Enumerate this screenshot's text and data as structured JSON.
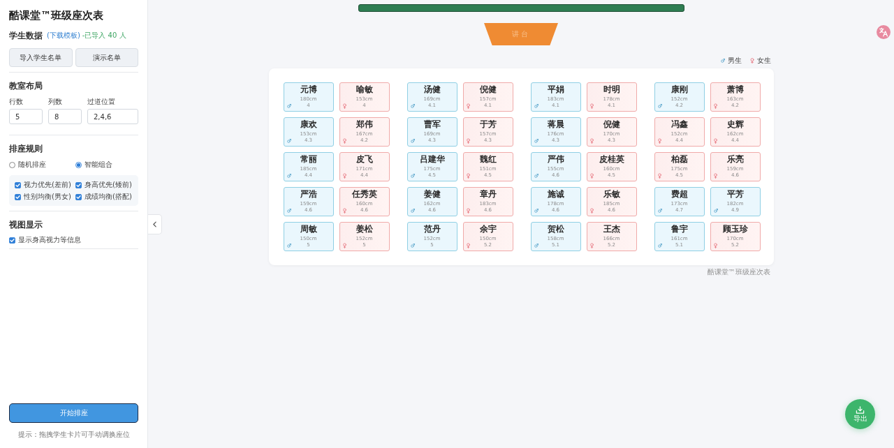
{
  "sidebar": {
    "title": "酷课堂™班级座次表",
    "student_data": {
      "heading": "学生数据",
      "template_link": "(下载模板)",
      "import_status": "-已导入 40 人",
      "buttons": [
        "导入学生名单",
        "演示名单"
      ]
    },
    "layout": {
      "heading": "教室布局",
      "fields": [
        {
          "label": "行数",
          "value": "5"
        },
        {
          "label": "列数",
          "value": "8"
        },
        {
          "label": "过道位置",
          "value": "2,4,6"
        }
      ]
    },
    "rules": {
      "heading": "排座规则",
      "modes": [
        {
          "label": "随机排座",
          "selected": false
        },
        {
          "label": "智能组合",
          "selected": true
        }
      ],
      "options": [
        {
          "label": "视力优先(差前)",
          "checked": true
        },
        {
          "label": "身高优先(矮前)",
          "checked": true
        },
        {
          "label": "性别均衡(男女)",
          "checked": true
        },
        {
          "label": "成绩均衡(搭配)",
          "checked": true
        }
      ]
    },
    "view": {
      "heading": "视图显示",
      "options": [
        {
          "label": "显示身高视力等信息",
          "checked": true
        }
      ]
    },
    "start_button": "开始排座",
    "hint": "提示：拖拽学生卡片可手动调换座位"
  },
  "classroom": {
    "podium": "讲台",
    "legend": [
      {
        "kind": "male",
        "label": "男生"
      },
      {
        "kind": "female",
        "label": "女生"
      }
    ],
    "seat_rows": [
      [
        [
          {
            "name": "元博",
            "kind": "male",
            "height": "180cm",
            "score": "4"
          },
          {
            "name": "喻敏",
            "kind": "female",
            "height": "153cm",
            "score": "4"
          }
        ],
        [
          {
            "name": "汤健",
            "kind": "male",
            "height": "169cm",
            "score": "4.1"
          },
          {
            "name": "倪健",
            "kind": "female",
            "height": "157cm",
            "score": "4.1"
          }
        ],
        [
          {
            "name": "平娟",
            "kind": "male",
            "height": "183cm",
            "score": "4.1"
          },
          {
            "name": "时明",
            "kind": "female",
            "height": "178cm",
            "score": "4.1"
          }
        ],
        [
          {
            "name": "康刚",
            "kind": "male",
            "height": "152cm",
            "score": "4.2"
          },
          {
            "name": "萧博",
            "kind": "female",
            "height": "163cm",
            "score": "4.2"
          }
        ]
      ],
      [
        [
          {
            "name": "康欢",
            "kind": "male",
            "height": "153cm",
            "score": "4.3"
          },
          {
            "name": "郑伟",
            "kind": "female",
            "height": "167cm",
            "score": "4.2"
          }
        ],
        [
          {
            "name": "曹军",
            "kind": "male",
            "height": "169cm",
            "score": "4.3"
          },
          {
            "name": "于芳",
            "kind": "female",
            "height": "157cm",
            "score": "4.3"
          }
        ],
        [
          {
            "name": "蒋晨",
            "kind": "male",
            "height": "176cm",
            "score": "4.3"
          },
          {
            "name": "倪健",
            "kind": "female",
            "height": "170cm",
            "score": "4.3"
          }
        ],
        [
          {
            "name": "冯鑫",
            "kind": "female",
            "height": "152cm",
            "score": "4.4"
          },
          {
            "name": "史辉",
            "kind": "female",
            "height": "162cm",
            "score": "4.4"
          }
        ]
      ],
      [
        [
          {
            "name": "常丽",
            "kind": "male",
            "height": "185cm",
            "score": "4.4"
          },
          {
            "name": "皮飞",
            "kind": "female",
            "height": "171cm",
            "score": "4.4"
          }
        ],
        [
          {
            "name": "吕建华",
            "kind": "male",
            "height": "175cm",
            "score": "4.5"
          },
          {
            "name": "魏红",
            "kind": "female",
            "height": "151cm",
            "score": "4.5"
          }
        ],
        [
          {
            "name": "严伟",
            "kind": "male",
            "height": "155cm",
            "score": "4.6"
          },
          {
            "name": "皮桂英",
            "kind": "female",
            "height": "160cm",
            "score": "4.5"
          }
        ],
        [
          {
            "name": "柏磊",
            "kind": "female",
            "height": "175cm",
            "score": "4.5"
          },
          {
            "name": "乐亮",
            "kind": "female",
            "height": "159cm",
            "score": "4.6"
          }
        ]
      ],
      [
        [
          {
            "name": "严浩",
            "kind": "male",
            "height": "159cm",
            "score": "4.6"
          },
          {
            "name": "任秀英",
            "kind": "female",
            "height": "160cm",
            "score": "4.6"
          }
        ],
        [
          {
            "name": "姜健",
            "kind": "male",
            "height": "162cm",
            "score": "4.6"
          },
          {
            "name": "章丹",
            "kind": "female",
            "height": "183cm",
            "score": "4.6"
          }
        ],
        [
          {
            "name": "施诚",
            "kind": "male",
            "height": "178cm",
            "score": "4.6"
          },
          {
            "name": "乐敏",
            "kind": "female",
            "height": "185cm",
            "score": "4.6"
          }
        ],
        [
          {
            "name": "费超",
            "kind": "male",
            "height": "173cm",
            "score": "4.7"
          },
          {
            "name": "平芳",
            "kind": "male",
            "height": "182cm",
            "score": "4.9"
          }
        ]
      ],
      [
        [
          {
            "name": "周敏",
            "kind": "male",
            "height": "150cm",
            "score": "5"
          },
          {
            "name": "姜松",
            "kind": "female",
            "height": "152cm",
            "score": "5"
          }
        ],
        [
          {
            "name": "范丹",
            "kind": "male",
            "height": "152cm",
            "score": "5"
          },
          {
            "name": "余宇",
            "kind": "female",
            "height": "150cm",
            "score": "5.2"
          }
        ],
        [
          {
            "name": "贺松",
            "kind": "male",
            "height": "158cm",
            "score": "5.1"
          },
          {
            "name": "王杰",
            "kind": "female",
            "height": "166cm",
            "score": "5.2"
          }
        ],
        [
          {
            "name": "鲁宇",
            "kind": "male",
            "height": "161cm",
            "score": "5.1"
          },
          {
            "name": "顾玉珍",
            "kind": "female",
            "height": "170cm",
            "score": "5.2"
          }
        ]
      ]
    ],
    "footer": "酷课堂™班级座次表"
  },
  "export_button": "导出"
}
